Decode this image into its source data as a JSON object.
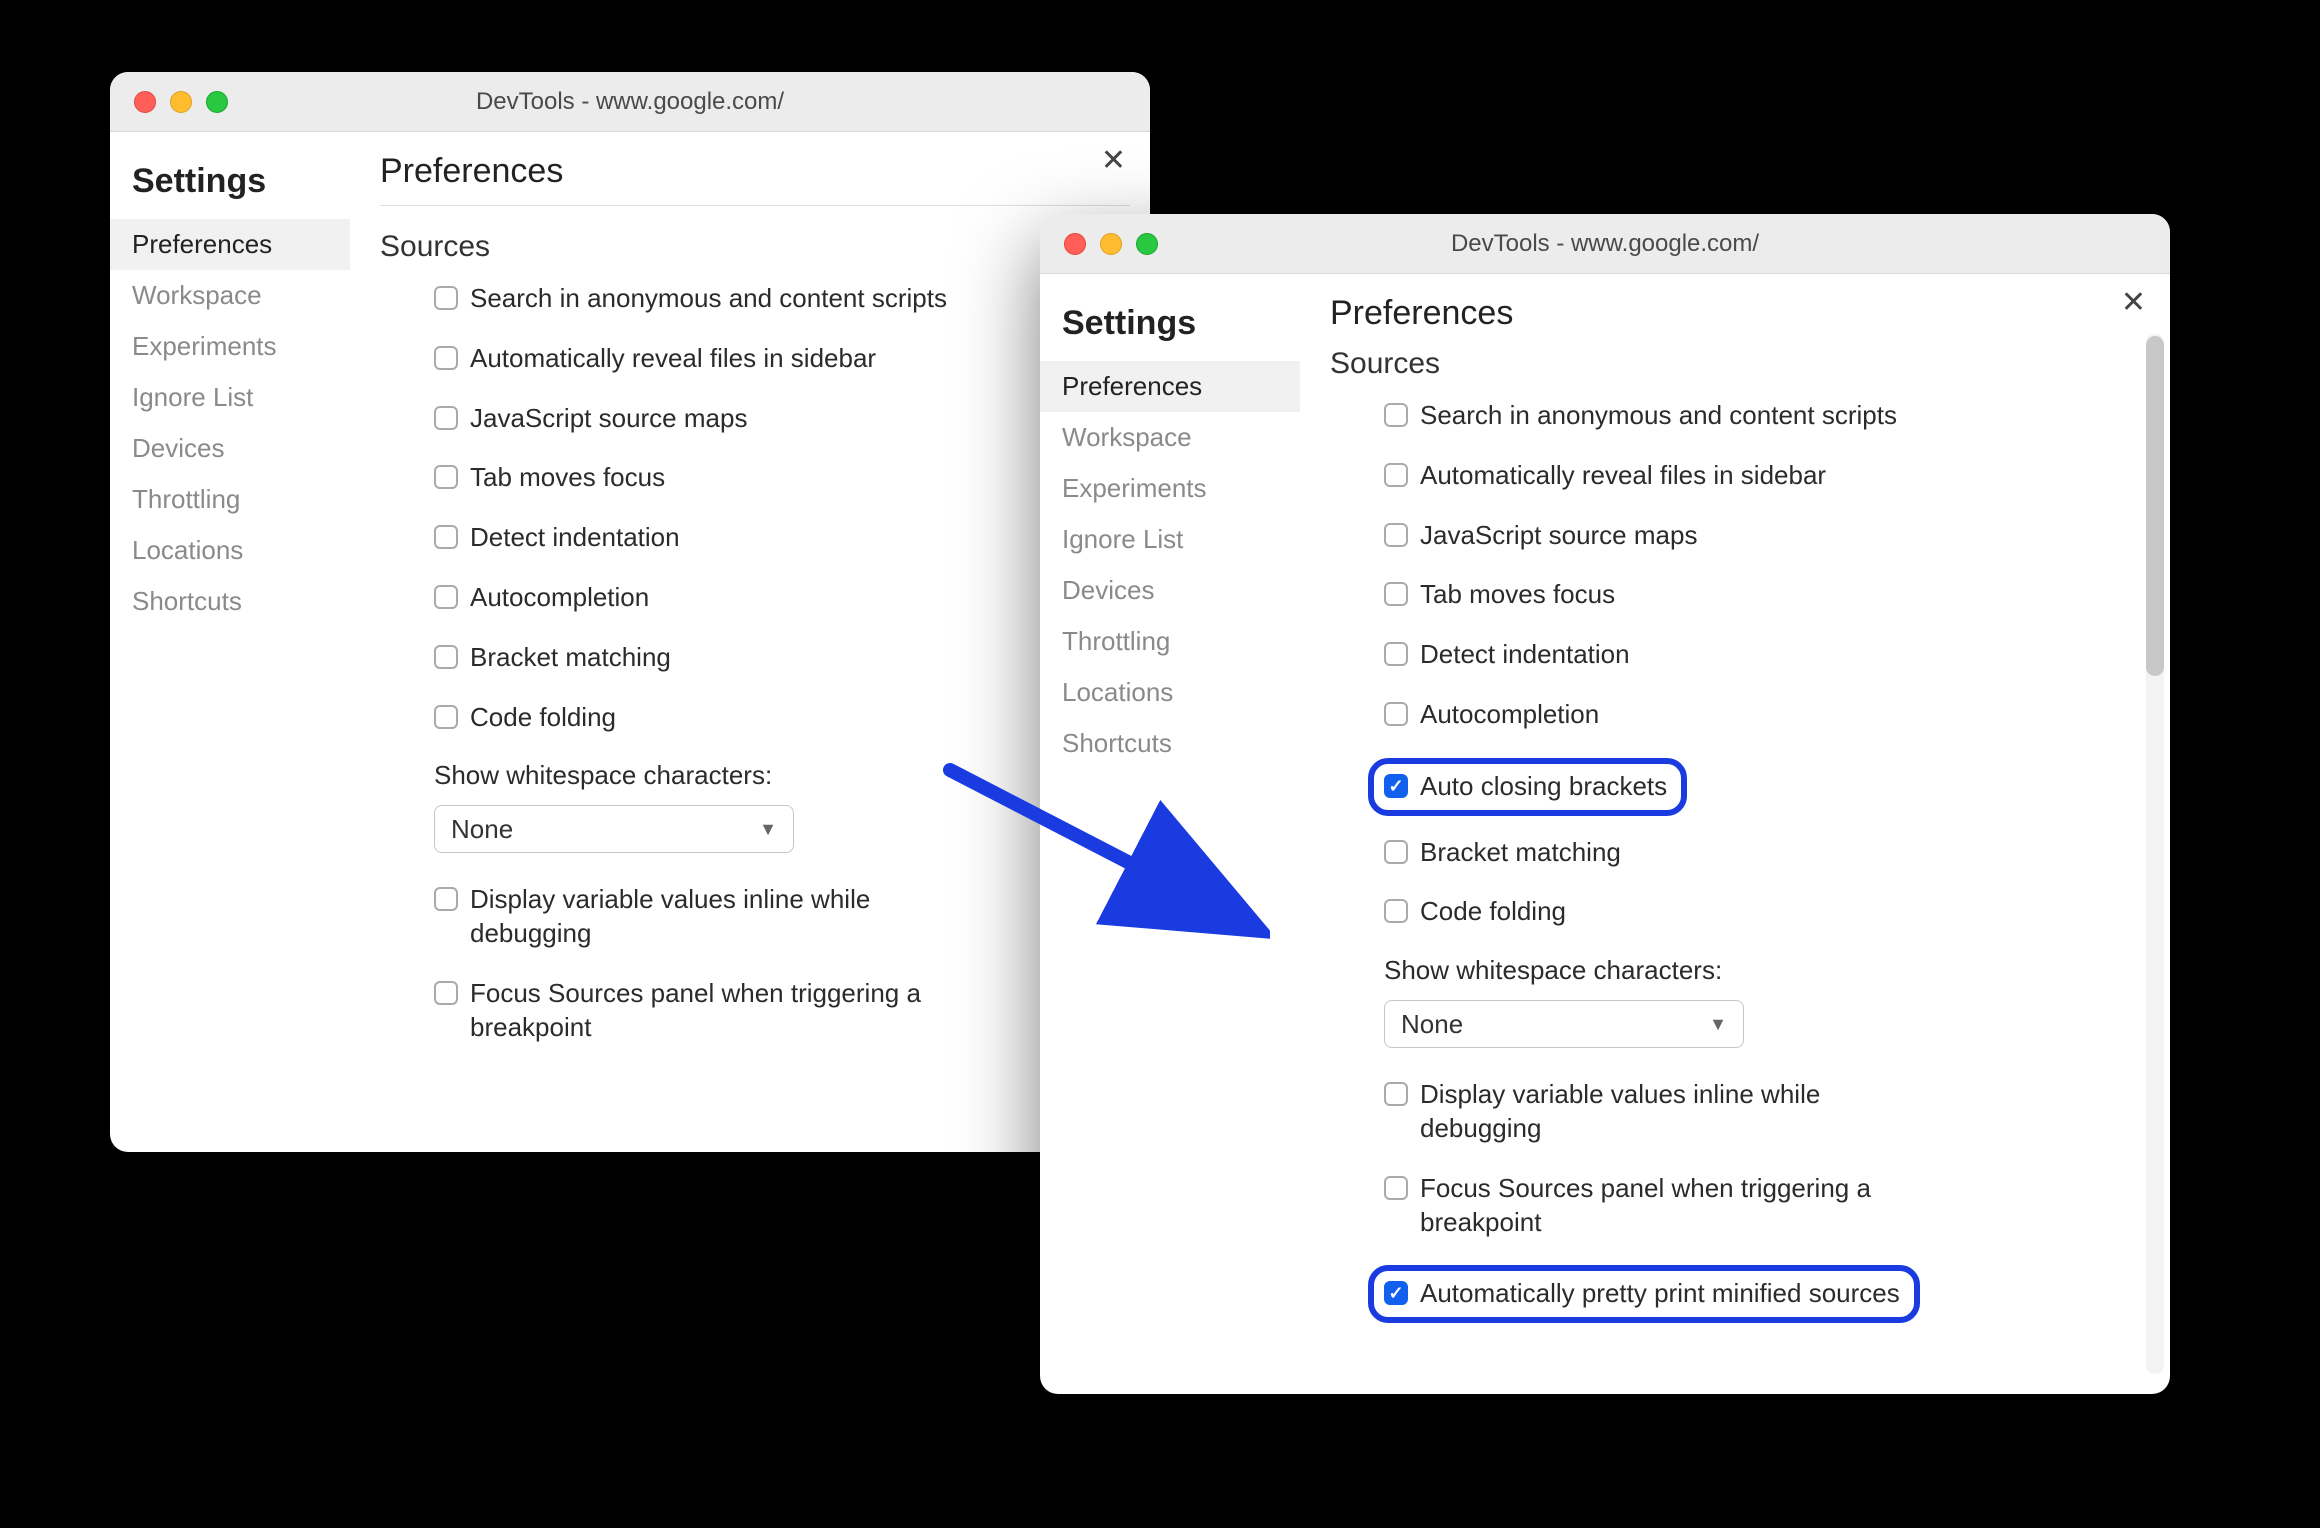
{
  "left": {
    "title": "DevTools - www.google.com/",
    "sidebar_title": "Settings",
    "main_title": "Preferences",
    "section": "Sources",
    "nav": [
      {
        "label": "Preferences",
        "active": true
      },
      {
        "label": "Workspace",
        "active": false
      },
      {
        "label": "Experiments",
        "active": false
      },
      {
        "label": "Ignore List",
        "active": false
      },
      {
        "label": "Devices",
        "active": false
      },
      {
        "label": "Throttling",
        "active": false
      },
      {
        "label": "Locations",
        "active": false
      },
      {
        "label": "Shortcuts",
        "active": false
      }
    ],
    "options": [
      {
        "label": "Search in anonymous and content scripts",
        "checked": false
      },
      {
        "label": "Automatically reveal files in sidebar",
        "checked": false
      },
      {
        "label": "JavaScript source maps",
        "checked": false
      },
      {
        "label": "Tab moves focus",
        "checked": false
      },
      {
        "label": "Detect indentation",
        "checked": false
      },
      {
        "label": "Autocompletion",
        "checked": false
      },
      {
        "label": "Bracket matching",
        "checked": false
      },
      {
        "label": "Code folding",
        "checked": false
      }
    ],
    "whitespace_label": "Show whitespace characters:",
    "whitespace_value": "None",
    "tail_options": [
      {
        "label": "Display variable values inline while debugging",
        "checked": false
      },
      {
        "label": "Focus Sources panel when triggering a breakpoint",
        "checked": false
      }
    ]
  },
  "right": {
    "title": "DevTools - www.google.com/",
    "sidebar_title": "Settings",
    "main_title": "Preferences",
    "section": "Sources",
    "nav": [
      {
        "label": "Preferences",
        "active": true
      },
      {
        "label": "Workspace",
        "active": false
      },
      {
        "label": "Experiments",
        "active": false
      },
      {
        "label": "Ignore List",
        "active": false
      },
      {
        "label": "Devices",
        "active": false
      },
      {
        "label": "Throttling",
        "active": false
      },
      {
        "label": "Locations",
        "active": false
      },
      {
        "label": "Shortcuts",
        "active": false
      }
    ],
    "options_top": [
      {
        "label": "Search in anonymous and content scripts",
        "checked": false
      },
      {
        "label": "Automatically reveal files in sidebar",
        "checked": false
      },
      {
        "label": "JavaScript source maps",
        "checked": false
      },
      {
        "label": "Tab moves focus",
        "checked": false
      },
      {
        "label": "Detect indentation",
        "checked": false
      },
      {
        "label": "Autocompletion",
        "checked": false
      }
    ],
    "highlight1": {
      "label": "Auto closing brackets",
      "checked": true
    },
    "options_mid": [
      {
        "label": "Bracket matching",
        "checked": false
      },
      {
        "label": "Code folding",
        "checked": false
      }
    ],
    "whitespace_label": "Show whitespace characters:",
    "whitespace_value": "None",
    "tail_options": [
      {
        "label": "Display variable values inline while debugging",
        "checked": false
      },
      {
        "label": "Focus Sources panel when triggering a breakpoint",
        "checked": false
      }
    ],
    "highlight2": {
      "label": "Automatically pretty print minified sources",
      "checked": true
    }
  },
  "colors": {
    "highlight_border": "#1a3be0",
    "checkbox_checked": "#1161ee"
  }
}
